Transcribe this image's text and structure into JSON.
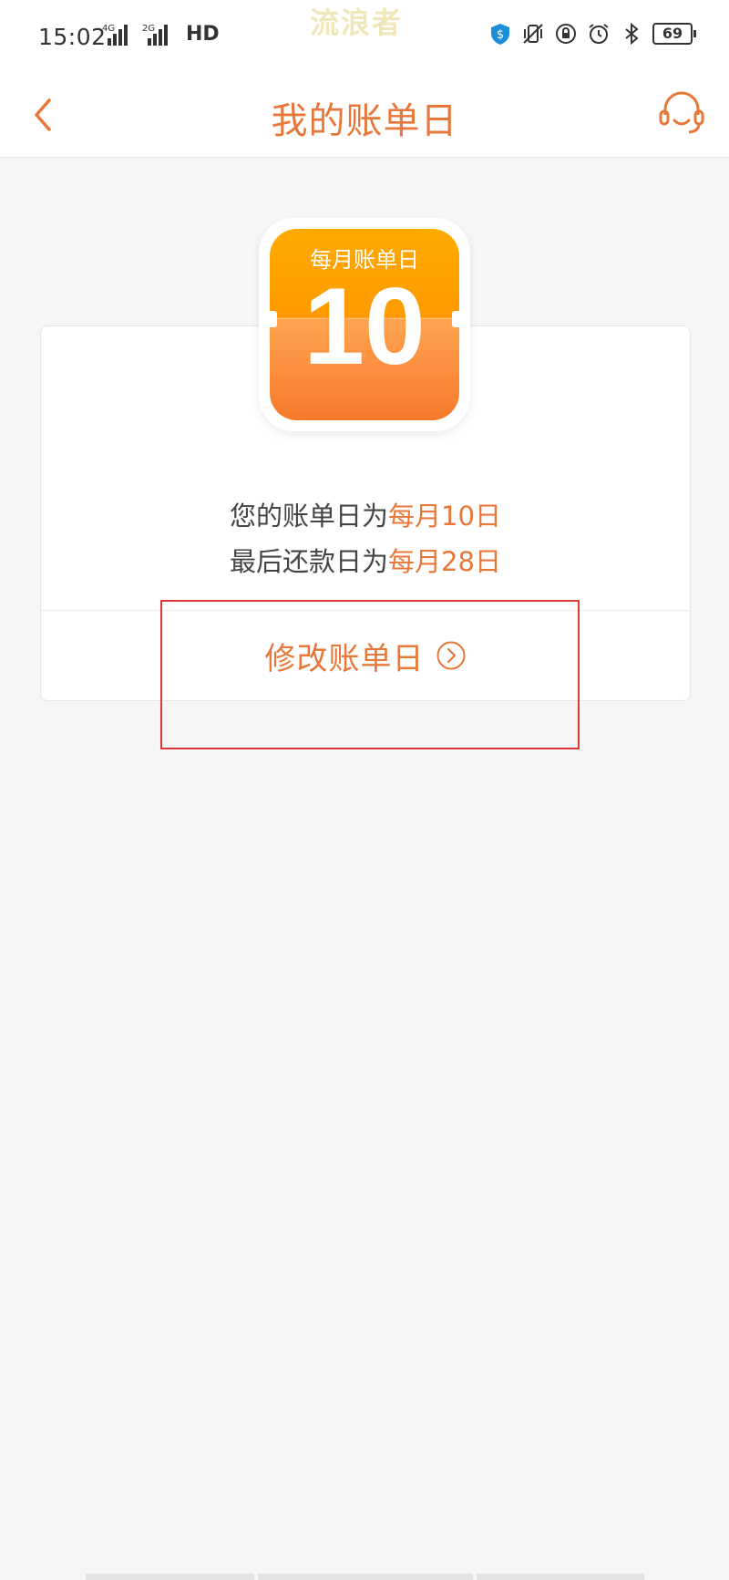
{
  "status_bar": {
    "time": "15:02",
    "signal_1_tag": "4G",
    "signal_2_tag": "2G",
    "hd_tag": "HD",
    "battery": "69",
    "watermark": "流浪者",
    "icons": [
      "shield-dollar-icon",
      "vibrate-mute-icon",
      "lock-rotation-icon",
      "alarm-icon",
      "bluetooth-icon"
    ]
  },
  "nav": {
    "title": "我的账单日",
    "back_icon": "chevron-left-icon",
    "service_icon": "headset-icon"
  },
  "calendar": {
    "label": "每月账单日",
    "day": "10"
  },
  "info": {
    "bill_prefix": "您的账单日为",
    "bill_value": "每月10日",
    "due_prefix": "最后还款日为",
    "due_value": "每月28日"
  },
  "action": {
    "modify_label": "修改账单日",
    "modify_icon": "circle-chevron-right-icon"
  },
  "colors": {
    "accent": "#e8783a",
    "background": "#f6f6f6",
    "annotation": "#d83a3a"
  }
}
